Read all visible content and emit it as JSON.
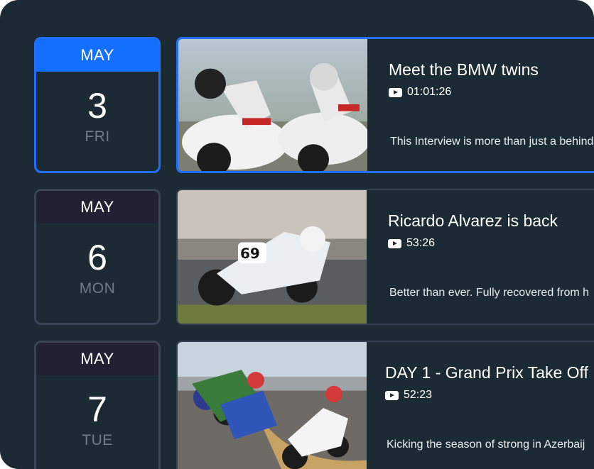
{
  "events": [
    {
      "month": "MAY",
      "day": "3",
      "weekday": "FRI",
      "title": "Meet the BMW twins",
      "duration": "01:01:26",
      "description": "This Interview is more than just a behind"
    },
    {
      "month": "MAY",
      "day": "6",
      "weekday": "MON",
      "title": "Ricardo Alvarez is back",
      "duration": "53:26",
      "description": "Better than ever. Fully recovered from h"
    },
    {
      "month": "MAY",
      "day": "7",
      "weekday": "TUE",
      "title": "DAY 1 - Grand Prix Take Off",
      "duration": "52:23",
      "description": "Kicking the season of strong in Azerbaij"
    }
  ],
  "colors": {
    "background": "#1c2a33",
    "accent": "#1370ff",
    "month_bar": "#222131",
    "muted_text": "#6f7b86"
  },
  "icons": {
    "duration": "youtube-play-icon"
  }
}
